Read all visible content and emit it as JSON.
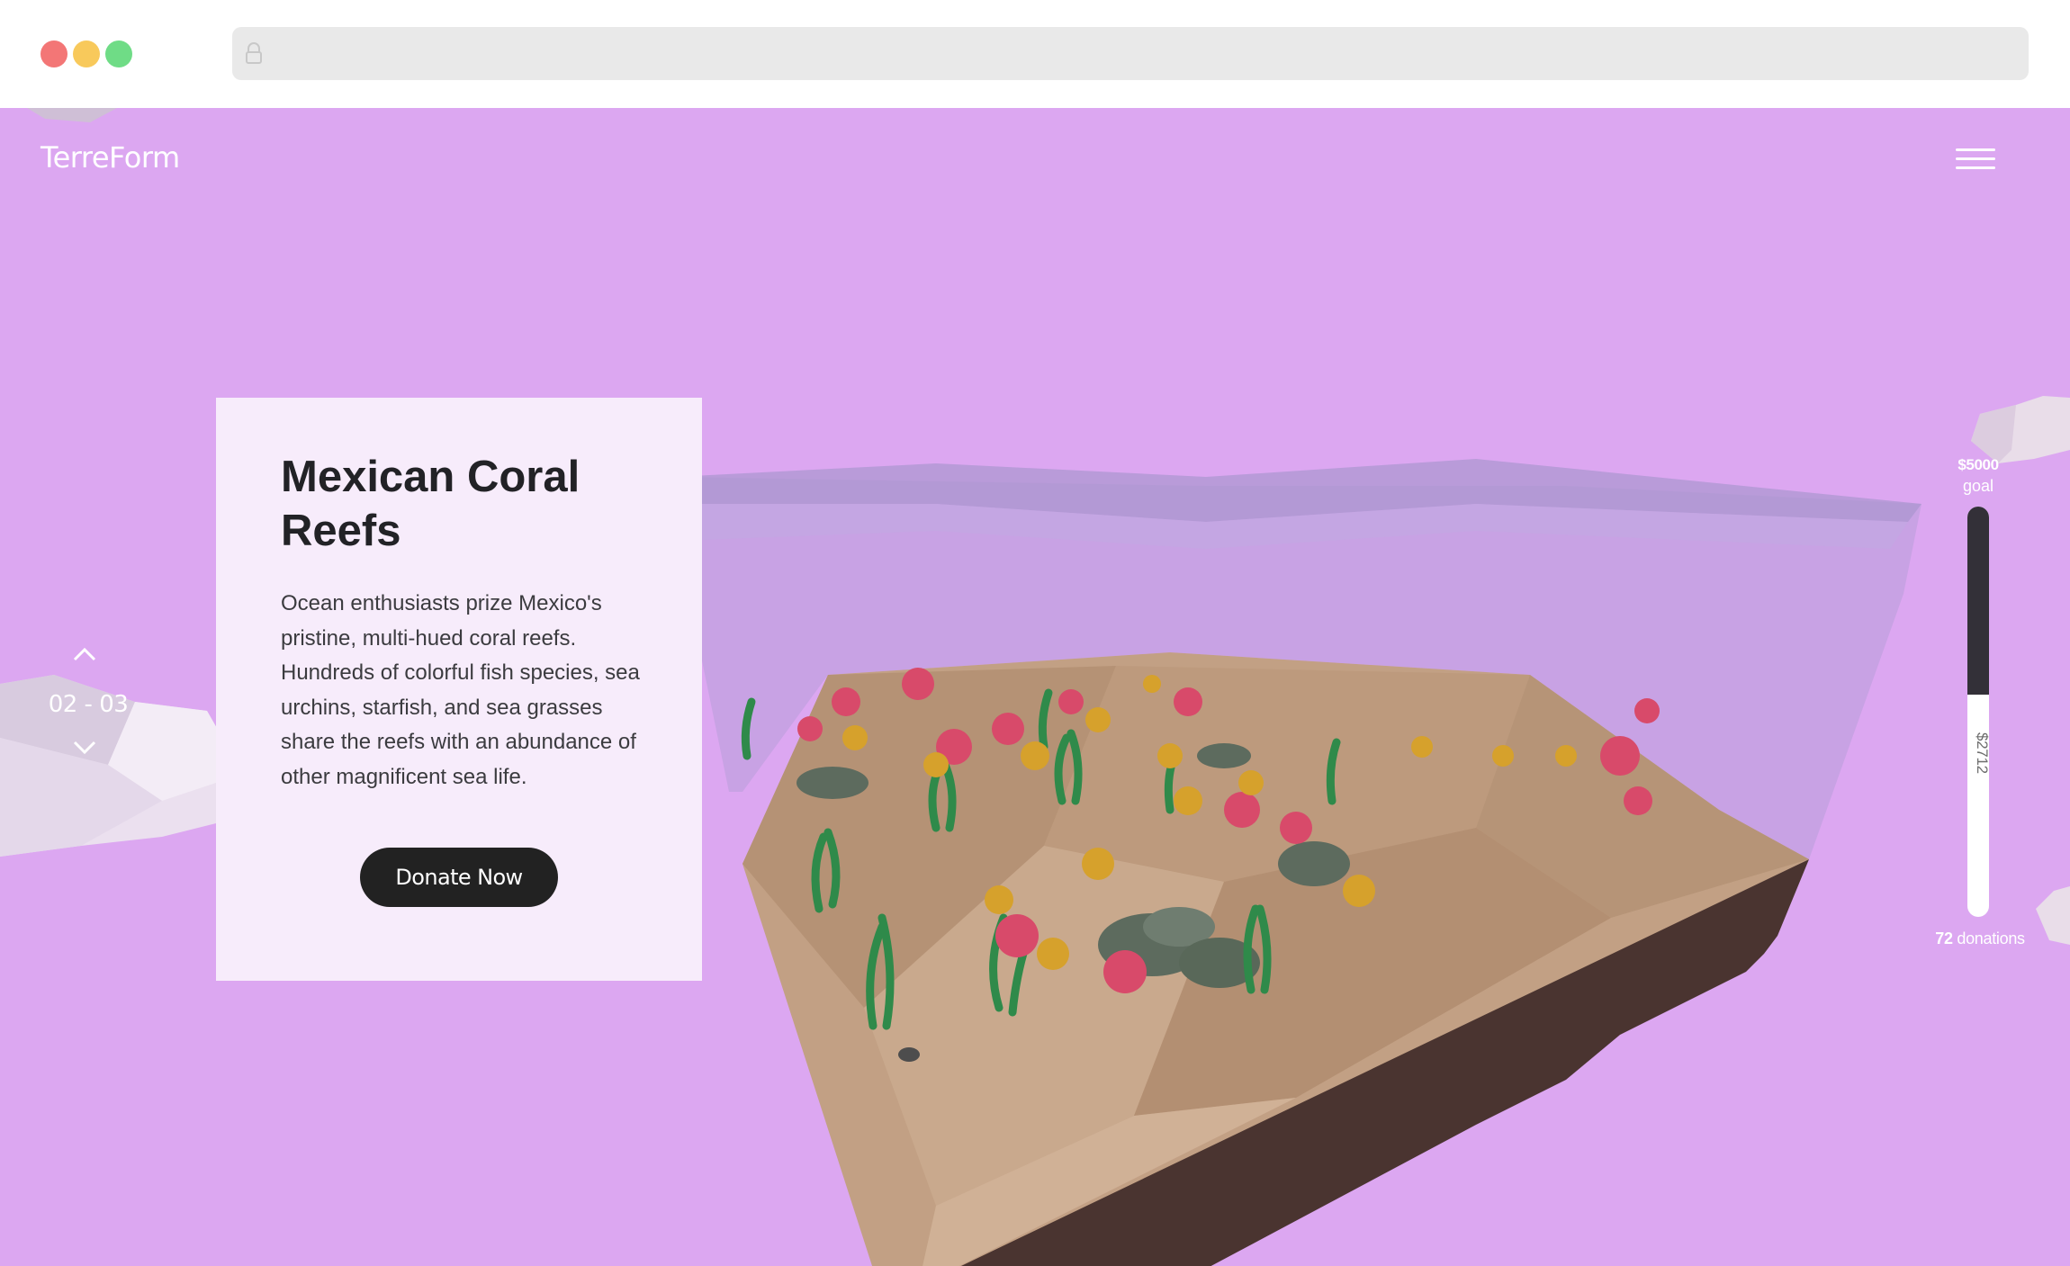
{
  "browser": {
    "window_controls": [
      "close",
      "minimize",
      "maximize"
    ],
    "address_bar_icon": "lock-icon"
  },
  "header": {
    "brand": "TerreForm",
    "menu_icon": "hamburger-menu-icon"
  },
  "card": {
    "title": "Mexican Coral Reefs",
    "description": "Ocean enthusiasts prize Mexico's pristine, multi-hued coral reefs. Hundreds of colorful fish species, sea urchins, starfish, and sea grasses share the reefs with an abundance of other magnificent sea life.",
    "donate_label": "Donate Now"
  },
  "slide_nav": {
    "counter": "02 - 03",
    "up_icon": "chevron-up-icon",
    "down_icon": "chevron-down-icon"
  },
  "progress": {
    "goal_amount": "$5000",
    "goal_label": "goal",
    "raised": "$2712",
    "raised_fraction": 0.5424,
    "donations_count": "72",
    "donations_label": "donations"
  },
  "colors": {
    "background": "#dca7f1",
    "card": "#f7ecfb",
    "button": "#222222",
    "meter_empty": "#333038",
    "meter_filled": "#ffffff"
  }
}
